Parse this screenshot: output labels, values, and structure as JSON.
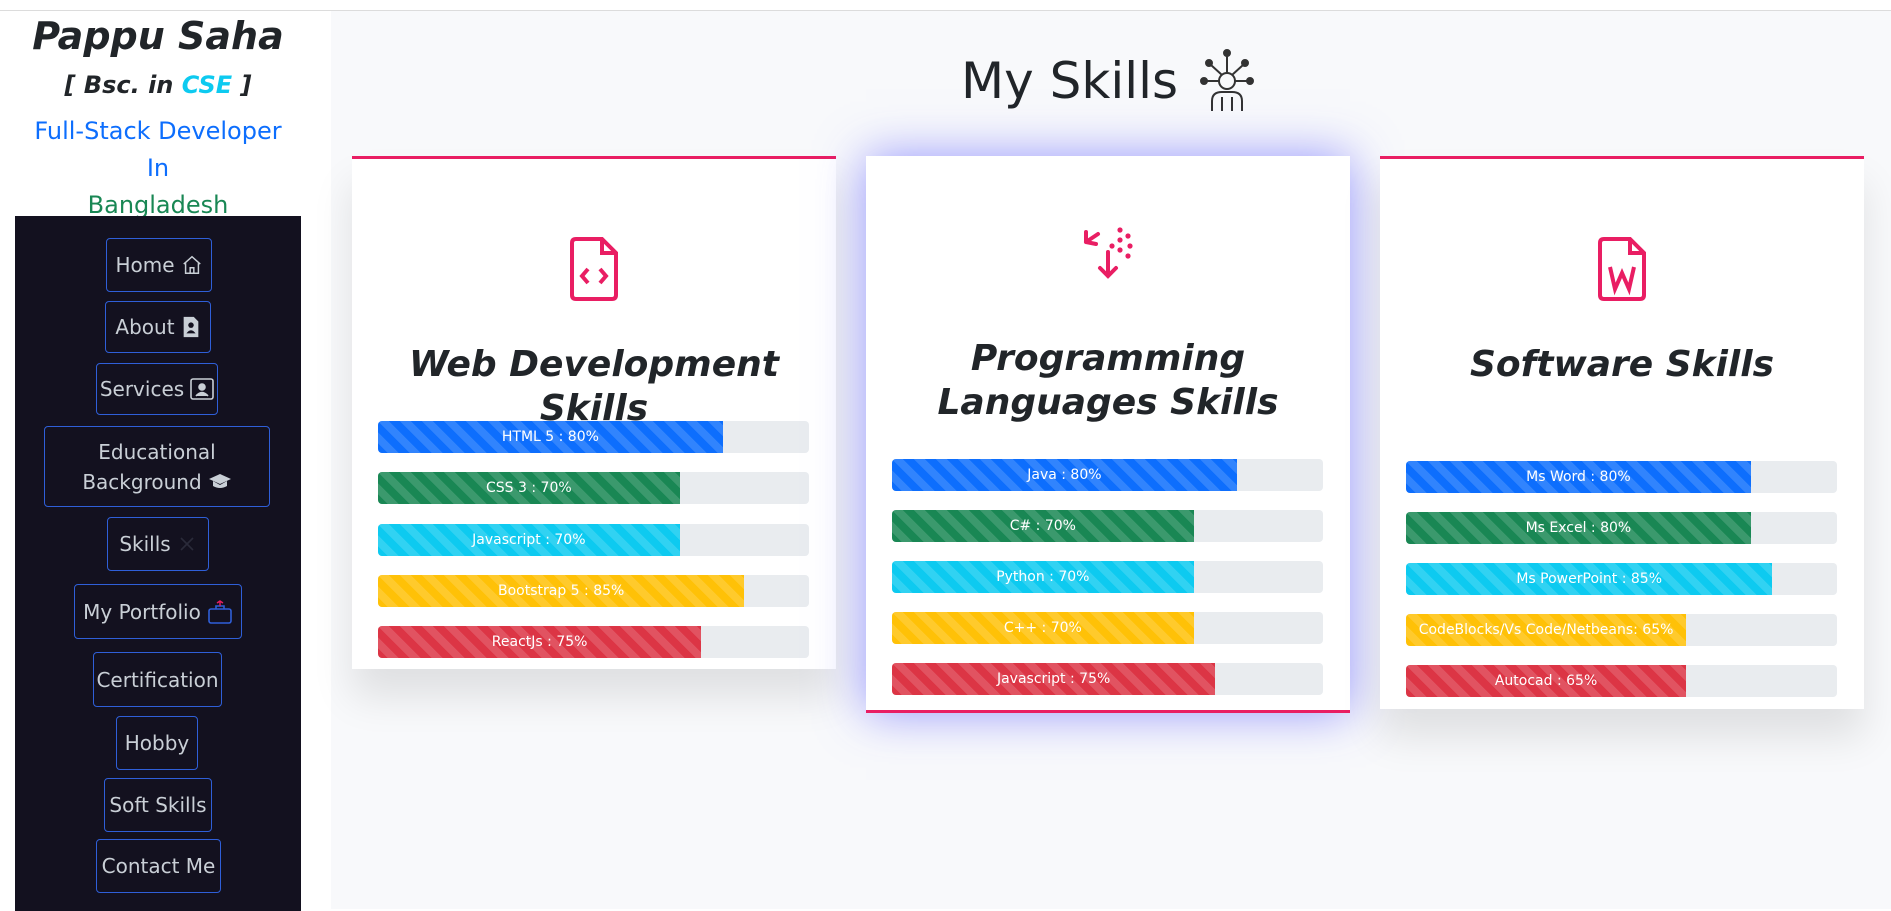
{
  "profile": {
    "name": "Pappu Saha",
    "degree_prefix": "[ Bsc. in",
    "degree_field": "CSE",
    "degree_suffix": "]",
    "role_line1": "Full-Stack Developer In",
    "role_line2": "Bangladesh"
  },
  "nav": {
    "home": "Home",
    "about": "About",
    "services": "Services",
    "education_1": "Educational",
    "education_2": "Background",
    "skills": "Skills",
    "portfolio": "My Portfolio",
    "certification": "Certification",
    "hobby": "Hobby",
    "soft_skills": "Soft Skills",
    "contact": "Contact Me"
  },
  "page": {
    "title": "My Skills"
  },
  "cards": [
    {
      "title": "Web Development Skills",
      "icon": "file-code-icon",
      "bars": [
        {
          "label": "HTML 5 : 80%",
          "value": 80,
          "color": "#0d6efd"
        },
        {
          "label": "CSS 3 : 70%",
          "value": 70,
          "color": "#198754"
        },
        {
          "label": "Javascript : 70%",
          "value": 70,
          "color": "#0dcaf0"
        },
        {
          "label": "Bootstrap 5 : 85%",
          "value": 85,
          "color": "#ffc107"
        },
        {
          "label": "ReactJs : 75%",
          "value": 75,
          "color": "#dc3545"
        }
      ]
    },
    {
      "title": "Programming Languages Skills",
      "icon": "box-arrow-icon",
      "bars": [
        {
          "label": "Java : 80%",
          "value": 80,
          "color": "#0d6efd"
        },
        {
          "label": "C# : 70%",
          "value": 70,
          "color": "#198754"
        },
        {
          "label": "Python : 70%",
          "value": 70,
          "color": "#0dcaf0"
        },
        {
          "label": "C++ : 70%",
          "value": 70,
          "color": "#ffc107"
        },
        {
          "label": "Javascript : 75%",
          "value": 75,
          "color": "#dc3545"
        }
      ]
    },
    {
      "title": "Software Skills",
      "icon": "file-word-icon",
      "bars": [
        {
          "label": "Ms Word : 80%",
          "value": 80,
          "color": "#0d6efd"
        },
        {
          "label": "Ms Excel : 80%",
          "value": 80,
          "color": "#198754"
        },
        {
          "label": "Ms PowerPoint : 85%",
          "value": 85,
          "color": "#0dcaf0"
        },
        {
          "label": "CodeBlocks/Vs Code/Netbeans: 65%",
          "value": 65,
          "color": "#ffc107"
        },
        {
          "label": "Autocad : 65%",
          "value": 65,
          "color": "#dc3545"
        }
      ]
    }
  ],
  "colors": {
    "accent": "#e91e63",
    "sidebar_bg": "#13111f",
    "nav_border": "#2f5fd8"
  }
}
